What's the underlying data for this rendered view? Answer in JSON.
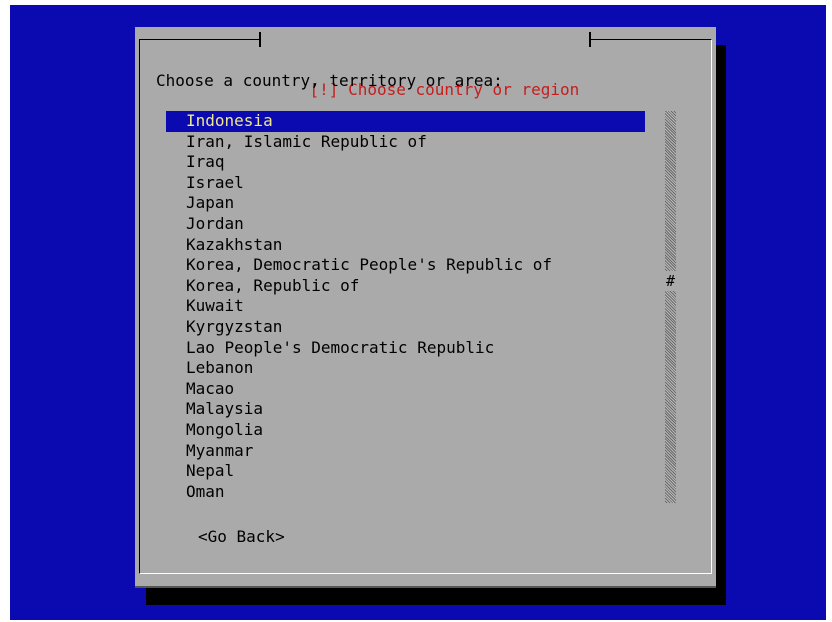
{
  "dialog": {
    "title": "[!] Choose country or region",
    "prompt": "Choose a country, territory or area:",
    "items": [
      {
        "label": "Indonesia",
        "selected": true
      },
      {
        "label": "Iran, Islamic Republic of"
      },
      {
        "label": "Iraq"
      },
      {
        "label": "Israel"
      },
      {
        "label": "Japan"
      },
      {
        "label": "Jordan"
      },
      {
        "label": "Kazakhstan"
      },
      {
        "label": "Korea, Democratic People's Republic of"
      },
      {
        "label": "Korea, Republic of"
      },
      {
        "label": "Kuwait"
      },
      {
        "label": "Kyrgyzstan"
      },
      {
        "label": "Lao People's Democratic Republic"
      },
      {
        "label": "Lebanon"
      },
      {
        "label": "Macao"
      },
      {
        "label": "Malaysia"
      },
      {
        "label": "Mongolia"
      },
      {
        "label": "Myanmar"
      },
      {
        "label": "Nepal"
      },
      {
        "label": "Oman"
      }
    ],
    "scroll_thumb_glyph": "#",
    "back_button": "<Go Back>"
  },
  "colors": {
    "background": "#0a0ab0",
    "dialog": "#aaaaaa",
    "title": "#c41e1e",
    "selection_bg": "#0a0ab0",
    "selection_fg": "#f0e68c"
  }
}
